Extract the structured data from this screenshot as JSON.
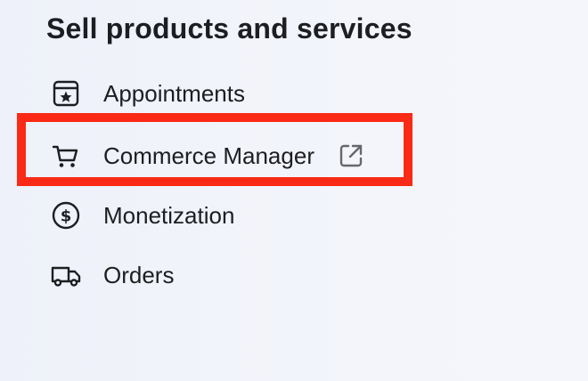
{
  "section": {
    "title": "Sell products and services"
  },
  "items": [
    {
      "label": "Appointments",
      "icon": "calendar-star-icon"
    },
    {
      "label": "Commerce Manager",
      "icon": "shopping-cart-icon",
      "external_icon": "external-link-icon"
    },
    {
      "label": "Monetization",
      "icon": "dollar-circle-icon"
    },
    {
      "label": "Orders",
      "icon": "delivery-truck-icon"
    }
  ],
  "colors": {
    "highlight": "#fa2a16",
    "text": "#1c1e21",
    "icon": "#1c1e21",
    "external_icon": "#65676b",
    "background": "#f2f4fa"
  }
}
